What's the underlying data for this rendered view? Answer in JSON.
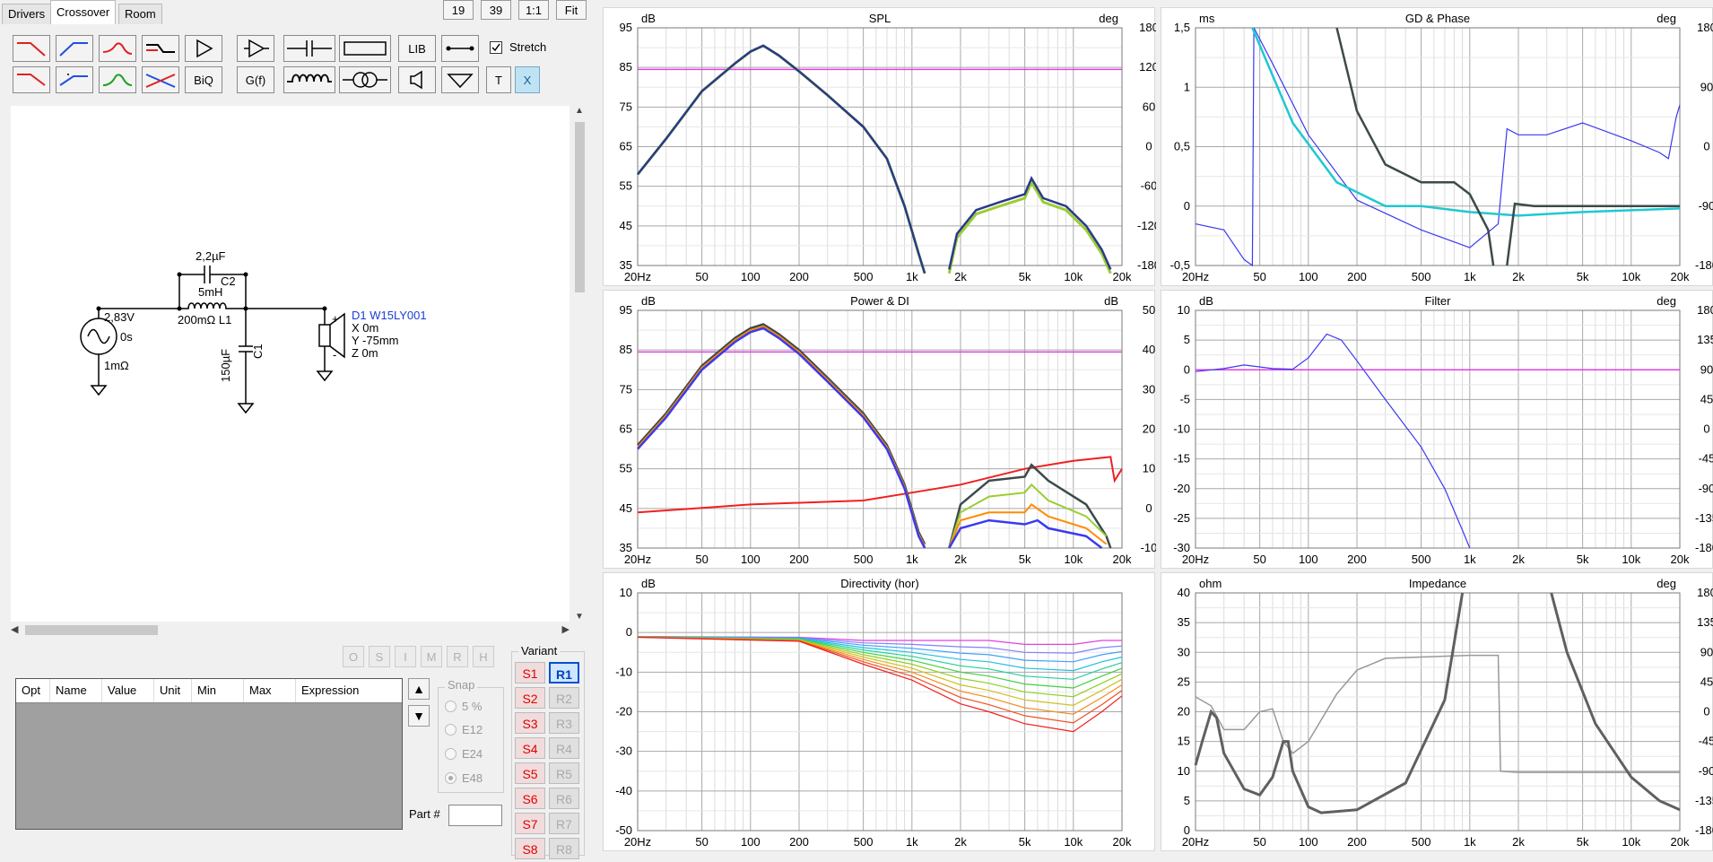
{
  "tabs": {
    "drivers": "Drivers",
    "crossover": "Crossover",
    "room": "Room"
  },
  "top_buttons": {
    "b19": "19",
    "b39": "39",
    "one": "1:1",
    "fit": "Fit"
  },
  "toolbar": {
    "lib": "LIB",
    "biq": "BiQ",
    "gf": "G(f)",
    "t": "T",
    "x": "X",
    "stretch": "Stretch"
  },
  "schematic": {
    "c2_value": "2,2µF",
    "c2_name": "C2",
    "l1_value": "5mH",
    "l1_res": "200mΩ L1",
    "src_volt": "2,83V",
    "src_delay": "0s",
    "src_res": "1mΩ",
    "c1_value": "150µF",
    "c1_name": "C1",
    "drv_name": "D1 W15LY001",
    "drv_x": "X 0m",
    "drv_y": "Y -75mm",
    "drv_z": "Z 0m"
  },
  "opt_buttons": [
    "O",
    "S",
    "I",
    "M",
    "R",
    "H"
  ],
  "params_table": {
    "headers": [
      "Opt",
      "Name",
      "Value",
      "Unit",
      "Min",
      "Max",
      "Expression"
    ]
  },
  "snap": {
    "label": "Snap",
    "options": [
      "5 %",
      "E12",
      "E24",
      "E48"
    ],
    "selected": "E48"
  },
  "variant": {
    "label": "Variant",
    "s": [
      "S1",
      "S2",
      "S3",
      "S4",
      "S5",
      "S6",
      "S7",
      "S8"
    ],
    "r": [
      "R1",
      "R2",
      "R3",
      "R4",
      "R5",
      "R6",
      "R7",
      "R8"
    ],
    "selected": "R1"
  },
  "part": {
    "label": "Part #",
    "value": ""
  },
  "freq_ticks": [
    "20Hz",
    "50",
    "100",
    "200",
    "500",
    "1k",
    "2k",
    "5k",
    "10k",
    "20k"
  ],
  "charts": {
    "spl": {
      "title": "SPL",
      "left_unit": "dB",
      "right_unit": "deg",
      "y": [
        "95",
        "85",
        "75",
        "65",
        "55",
        "45",
        "35"
      ],
      "yr": [
        "180",
        "120",
        "60",
        "0",
        "-60",
        "-120",
        "-180"
      ]
    },
    "gd": {
      "title": "GD & Phase",
      "left_unit": "ms",
      "right_unit": "deg",
      "y": [
        "1,5",
        "1",
        "0,5",
        "0",
        "-0,5"
      ],
      "yr": [
        "180",
        "90",
        "0",
        "-90",
        "-180"
      ]
    },
    "power": {
      "title": "Power & DI",
      "left_unit": "dB",
      "right_unit": "dB",
      "y": [
        "95",
        "85",
        "75",
        "65",
        "55",
        "45",
        "35"
      ],
      "yr": [
        "50",
        "40",
        "30",
        "20",
        "10",
        "0",
        "-10"
      ]
    },
    "filter": {
      "title": "Filter",
      "left_unit": "dB",
      "right_unit": "deg",
      "y": [
        "10",
        "5",
        "0",
        "-5",
        "-10",
        "-15",
        "-20",
        "-25",
        "-30"
      ],
      "yr": [
        "180",
        "135",
        "90",
        "45",
        "0",
        "-45",
        "-90",
        "-135",
        "-180"
      ]
    },
    "directivity": {
      "title": "Directivity (hor)",
      "left_unit": "dB",
      "y": [
        "10",
        "0",
        "-10",
        "-20",
        "-30",
        "-40",
        "-50"
      ]
    },
    "impedance": {
      "title": "Impedance",
      "left_unit": "ohm",
      "right_unit": "deg",
      "y": [
        "40",
        "35",
        "30",
        "25",
        "20",
        "15",
        "10",
        "5",
        "0"
      ],
      "yr": [
        "180",
        "135",
        "90",
        "45",
        "0",
        "-45",
        "-90",
        "-135",
        "-180"
      ]
    }
  },
  "colors": {
    "navy": "#2a3a8a",
    "magenta": "#e040e0",
    "blue": "#3a3af0",
    "cyan": "#20c8d0",
    "dark": "#3c4a4a",
    "red": "#f02020",
    "green": "#9acd32",
    "orange": "#ff8c00"
  }
}
